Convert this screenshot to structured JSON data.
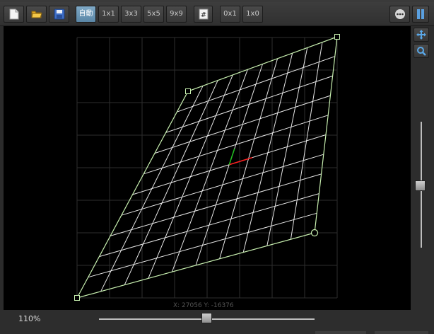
{
  "toolbar": {
    "new_icon": "new-document-icon",
    "open_icon": "open-folder-icon",
    "save_icon": "save-disk-icon",
    "auto_label": "自動",
    "grid_1x1": "1x1",
    "grid_3x3": "3x3",
    "grid_5x5": "5x5",
    "grid_9x9": "9x9",
    "grid_toggle_icon": "grid-hash-icon",
    "reset_0x1": "0x1",
    "reset_1x0": "1x0",
    "more_icon": "more-options-icon",
    "panel_icon": "panel-toggle-icon"
  },
  "side": {
    "move_icon": "move-arrows-icon",
    "zoom_icon": "magnifier-icon"
  },
  "canvas": {
    "coords": "X: 27056  Y: -16376",
    "accent_line": "#c8f0b0",
    "grid_line": "#ffffff",
    "ref_grid": "#2e2e2e",
    "center_red": "#ff2020",
    "center_green": "#20c020"
  },
  "status": {
    "zoom_level": "110%",
    "zoom_slider_fraction": 0.5
  }
}
